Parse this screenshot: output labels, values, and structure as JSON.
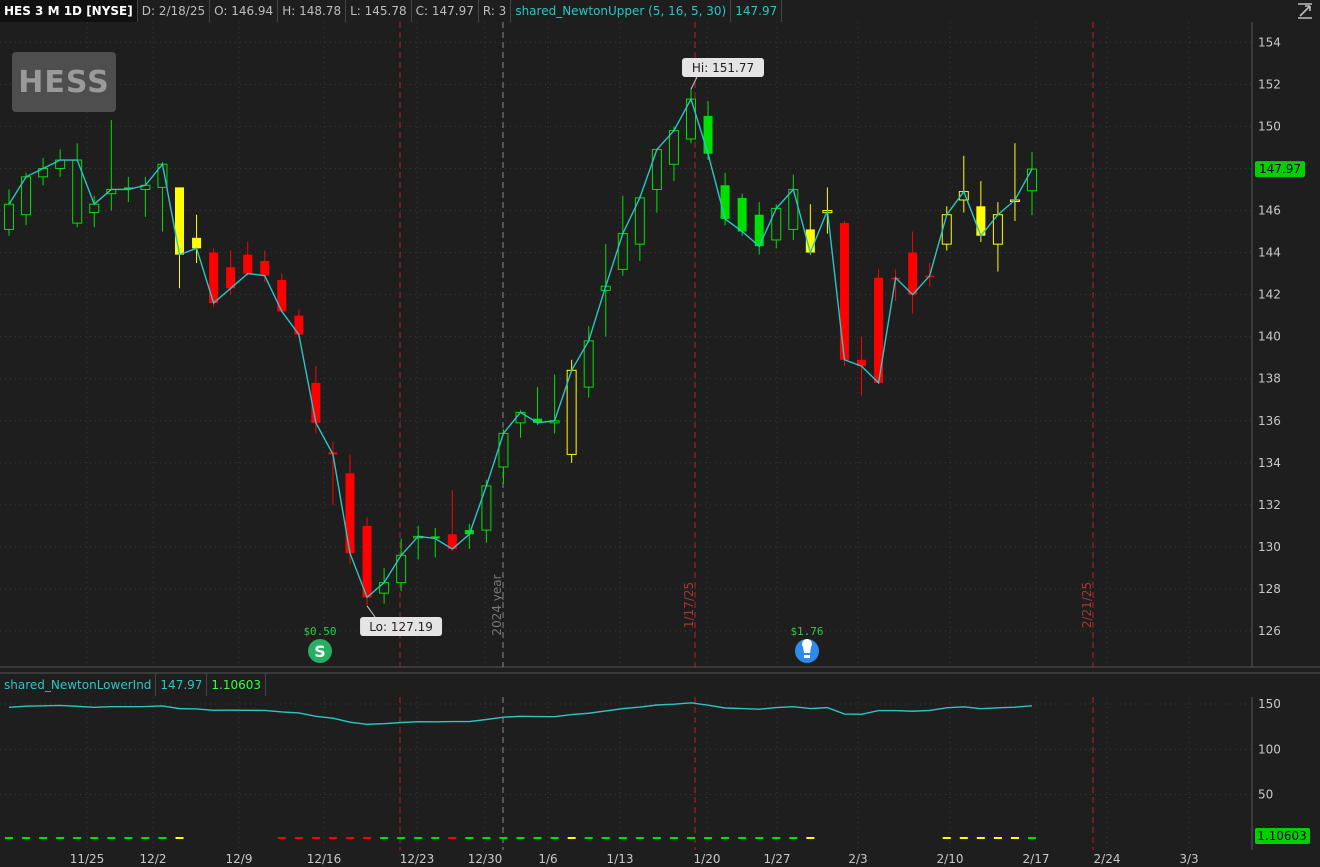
{
  "header": {
    "symbol": "HES 3 M 1D [NYSE]",
    "date": "D: 2/18/25",
    "open": "O: 146.94",
    "high": "H: 148.78",
    "low": "L: 145.78",
    "close": "C: 147.97",
    "range": "R: 3",
    "study": "shared_NewtonUpper (5, 16, 5, 30)",
    "study_value": "147.97"
  },
  "lower_header": {
    "study": "shared_NewtonLowerInd",
    "value1": "147.97",
    "value2": "1.10603"
  },
  "logo_text": "HESS",
  "colors": {
    "up": "#00e000",
    "down": "#ff0000",
    "neutral": "#ffff00",
    "line": "#2ec4c4",
    "grid": "#3a3a3a",
    "background": "#1e1e1e"
  },
  "chart_data": [
    {
      "type": "candlestick",
      "title": "",
      "ylim": [
        124.5,
        155
      ],
      "y_ticks": [
        126,
        128,
        130,
        132,
        134,
        136,
        138,
        140,
        142,
        144,
        146,
        148,
        150,
        152,
        154
      ],
      "x_tick_labels": [
        "11/25",
        "12/2",
        "12/9",
        "12/16",
        "12/23",
        "12/30",
        "1/6",
        "1/13",
        "1/20",
        "1/27",
        "2/3",
        "2/10",
        "2/17",
        "2/24",
        "3/3"
      ],
      "candles": [
        {
          "date": "11/20",
          "o": 145.1,
          "h": 147.0,
          "l": 144.8,
          "c": 146.3,
          "color": "up"
        },
        {
          "date": "11/21",
          "o": 145.8,
          "h": 147.8,
          "l": 145.3,
          "c": 147.6,
          "color": "up"
        },
        {
          "date": "11/22",
          "o": 147.6,
          "h": 148.5,
          "l": 147.2,
          "c": 148.0,
          "color": "up"
        },
        {
          "date": "11/25",
          "o": 148.0,
          "h": 148.9,
          "l": 147.6,
          "c": 148.4,
          "color": "up"
        },
        {
          "date": "11/26",
          "o": 145.4,
          "h": 149.2,
          "l": 145.2,
          "c": 148.4,
          "color": "up"
        },
        {
          "date": "11/27",
          "o": 145.9,
          "h": 146.7,
          "l": 145.2,
          "c": 146.3,
          "color": "up"
        },
        {
          "date": "11/29",
          "o": 146.8,
          "h": 150.3,
          "l": 146.0,
          "c": 147.0,
          "color": "up"
        },
        {
          "date": "12/2",
          "o": 147.1,
          "h": 147.6,
          "l": 146.4,
          "c": 147.0,
          "color": "up"
        },
        {
          "date": "12/3",
          "o": 147.0,
          "h": 147.6,
          "l": 145.7,
          "c": 147.2,
          "color": "up"
        },
        {
          "date": "12/4",
          "o": 147.1,
          "h": 148.3,
          "l": 145.0,
          "c": 148.2,
          "color": "up"
        },
        {
          "date": "12/5",
          "o": 147.1,
          "h": 147.1,
          "l": 142.3,
          "c": 143.9,
          "color": "neutral"
        },
        {
          "date": "12/6",
          "o": 144.7,
          "h": 145.8,
          "l": 143.5,
          "c": 144.2,
          "color": "neutral"
        },
        {
          "date": "12/9",
          "o": 144.0,
          "h": 144.2,
          "l": 141.4,
          "c": 141.6,
          "color": "down"
        },
        {
          "date": "12/10",
          "o": 143.3,
          "h": 144.1,
          "l": 142.0,
          "c": 142.3,
          "color": "down"
        },
        {
          "date": "12/11",
          "o": 143.9,
          "h": 144.5,
          "l": 142.9,
          "c": 143.0,
          "color": "down"
        },
        {
          "date": "12/12",
          "o": 143.6,
          "h": 144.1,
          "l": 142.6,
          "c": 142.9,
          "color": "down"
        },
        {
          "date": "12/13",
          "o": 142.7,
          "h": 143.0,
          "l": 141.2,
          "c": 141.2,
          "color": "down"
        },
        {
          "date": "12/16",
          "o": 141.0,
          "h": 141.3,
          "l": 140.0,
          "c": 140.1,
          "color": "down"
        },
        {
          "date": "12/17",
          "o": 137.8,
          "h": 138.6,
          "l": 135.4,
          "c": 135.9,
          "color": "down"
        },
        {
          "date": "12/18",
          "o": 134.5,
          "h": 135.0,
          "l": 132.0,
          "c": 134.4,
          "color": "down"
        },
        {
          "date": "12/19",
          "o": 133.5,
          "h": 134.4,
          "l": 129.2,
          "c": 129.7,
          "color": "down"
        },
        {
          "date": "12/20",
          "o": 131.0,
          "h": 131.4,
          "l": 127.2,
          "c": 127.6,
          "color": "down"
        },
        {
          "date": "12/23",
          "o": 127.8,
          "h": 129.0,
          "l": 127.3,
          "c": 128.3,
          "color": "up"
        },
        {
          "date": "12/24",
          "o": 128.3,
          "h": 130.4,
          "l": 127.9,
          "c": 129.6,
          "color": "up"
        },
        {
          "date": "12/26",
          "o": 130.5,
          "h": 131.0,
          "l": 129.4,
          "c": 130.5,
          "color": "up"
        },
        {
          "date": "12/27",
          "o": 130.5,
          "h": 130.9,
          "l": 129.5,
          "c": 130.4,
          "color": "up"
        },
        {
          "date": "12/30",
          "o": 130.6,
          "h": 132.7,
          "l": 129.8,
          "c": 129.9,
          "color": "down"
        },
        {
          "date": "12/31",
          "o": 130.8,
          "h": 131.1,
          "l": 129.9,
          "c": 130.6,
          "color": "up"
        },
        {
          "date": "1/2",
          "o": 130.8,
          "h": 133.2,
          "l": 130.2,
          "c": 132.9,
          "color": "up"
        },
        {
          "date": "1/3",
          "o": 133.8,
          "h": 135.6,
          "l": 133.0,
          "c": 135.4,
          "color": "up"
        },
        {
          "date": "1/6",
          "o": 135.9,
          "h": 136.5,
          "l": 135.2,
          "c": 136.4,
          "color": "up"
        },
        {
          "date": "1/7",
          "o": 136.1,
          "h": 137.6,
          "l": 135.8,
          "c": 135.9,
          "color": "up"
        },
        {
          "date": "1/8",
          "o": 135.9,
          "h": 138.2,
          "l": 135.4,
          "c": 136.0,
          "color": "up"
        },
        {
          "date": "1/10",
          "o": 134.4,
          "h": 138.9,
          "l": 134.0,
          "c": 138.4,
          "color": "neutral"
        },
        {
          "date": "1/13",
          "o": 137.6,
          "h": 140.5,
          "l": 137.1,
          "c": 139.8,
          "color": "up"
        },
        {
          "date": "1/14",
          "o": 142.2,
          "h": 144.4,
          "l": 140.0,
          "c": 142.4,
          "color": "up"
        },
        {
          "date": "1/15",
          "o": 143.2,
          "h": 146.7,
          "l": 142.9,
          "c": 144.9,
          "color": "up"
        },
        {
          "date": "1/16",
          "o": 144.4,
          "h": 146.7,
          "l": 143.6,
          "c": 146.6,
          "color": "up"
        },
        {
          "date": "1/17",
          "o": 147.0,
          "h": 148.9,
          "l": 145.9,
          "c": 148.9,
          "color": "up"
        },
        {
          "date": "1/21",
          "o": 148.2,
          "h": 150.0,
          "l": 147.4,
          "c": 149.8,
          "color": "up"
        },
        {
          "date": "1/22",
          "o": 149.4,
          "h": 151.8,
          "l": 149.2,
          "c": 151.3,
          "color": "up"
        },
        {
          "date": "1/23",
          "o": 150.5,
          "h": 151.2,
          "l": 148.4,
          "c": 148.7,
          "color": "up"
        },
        {
          "date": "1/24",
          "o": 147.2,
          "h": 147.8,
          "l": 145.3,
          "c": 145.6,
          "color": "up"
        },
        {
          "date": "1/27",
          "o": 146.6,
          "h": 146.8,
          "l": 144.8,
          "c": 145.0,
          "color": "up"
        },
        {
          "date": "1/28",
          "o": 145.8,
          "h": 146.4,
          "l": 143.9,
          "c": 144.3,
          "color": "up"
        },
        {
          "date": "1/29",
          "o": 144.6,
          "h": 146.3,
          "l": 144.2,
          "c": 146.1,
          "color": "up"
        },
        {
          "date": "1/30",
          "o": 145.1,
          "h": 147.7,
          "l": 144.6,
          "c": 147.0,
          "color": "up"
        },
        {
          "date": "1/31",
          "o": 145.1,
          "h": 146.3,
          "l": 143.9,
          "c": 144.0,
          "color": "neutral"
        },
        {
          "date": "2/3",
          "o": 145.9,
          "h": 147.1,
          "l": 144.9,
          "c": 146.0,
          "color": "neutral"
        },
        {
          "date": "2/4",
          "o": 145.4,
          "h": 145.5,
          "l": 138.6,
          "c": 138.9,
          "color": "down"
        },
        {
          "date": "2/5",
          "o": 138.9,
          "h": 140.0,
          "l": 137.2,
          "c": 138.6,
          "color": "down"
        },
        {
          "date": "2/6",
          "o": 142.8,
          "h": 143.2,
          "l": 137.8,
          "c": 137.8,
          "color": "down"
        },
        {
          "date": "2/7",
          "o": 142.8,
          "h": 143.2,
          "l": 141.7,
          "c": 142.8,
          "color": "down"
        },
        {
          "date": "2/10",
          "o": 144.0,
          "h": 145.0,
          "l": 141.1,
          "c": 142.0,
          "color": "down"
        },
        {
          "date": "2/11",
          "o": 142.9,
          "h": 143.5,
          "l": 142.4,
          "c": 142.9,
          "color": "down"
        },
        {
          "date": "2/12",
          "o": 144.4,
          "h": 146.2,
          "l": 144.1,
          "c": 145.8,
          "color": "neutral"
        },
        {
          "date": "2/13",
          "o": 146.5,
          "h": 148.6,
          "l": 145.9,
          "c": 146.9,
          "color": "neutral"
        },
        {
          "date": "2/14",
          "o": 146.2,
          "h": 147.4,
          "l": 144.5,
          "c": 144.8,
          "color": "neutral"
        },
        {
          "date": "2/17",
          "o": 144.4,
          "h": 146.4,
          "l": 143.1,
          "c": 145.8,
          "color": "neutral"
        },
        {
          "date": "2/18",
          "o": 146.5,
          "h": 149.2,
          "l": 145.5,
          "c": 146.5,
          "color": "neutral"
        },
        {
          "date": "2/19",
          "o": 146.94,
          "h": 148.78,
          "l": 145.78,
          "c": 147.97,
          "color": "up"
        }
      ],
      "hi_label": "Hi: 151.77",
      "lo_label": "Lo: 127.19",
      "last_price_label": "147.97",
      "event_labels": [
        "2024 year",
        "1/17/25",
        "2/21/25"
      ],
      "dividends": [
        {
          "date": "12/17",
          "label": "$0.50",
          "icon": "dividend-dollar-icon"
        },
        {
          "date": "1/30",
          "label": "$1.76",
          "icon": "earnings-lightbulb-icon"
        }
      ]
    },
    {
      "type": "line",
      "title": "",
      "ylim": [
        0,
        170
      ],
      "y_ticks": [
        50,
        100,
        150
      ],
      "series": [
        {
          "name": "shared_NewtonLowerInd",
          "values": [
            146.3,
            147.6,
            148.0,
            148.4,
            147.5,
            146.3,
            147.0,
            147.0,
            147.2,
            147.9,
            144.9,
            144.5,
            143.0,
            143.2,
            143.0,
            142.9,
            141.2,
            140.1,
            136.4,
            134.4,
            129.9,
            127.6,
            128.3,
            129.6,
            130.5,
            130.4,
            130.6,
            130.6,
            132.9,
            135.4,
            136.4,
            136.1,
            136.0,
            138.3,
            139.8,
            142.4,
            144.9,
            146.6,
            148.9,
            149.8,
            151.3,
            148.7,
            145.6,
            145.0,
            144.3,
            146.1,
            147.0,
            145.0,
            146.0,
            138.9,
            138.6,
            142.8,
            142.8,
            142.0,
            142.9,
            145.8,
            146.9,
            144.8,
            145.8,
            146.5,
            147.97
          ]
        }
      ],
      "last_value_label": "1.10603"
    }
  ]
}
